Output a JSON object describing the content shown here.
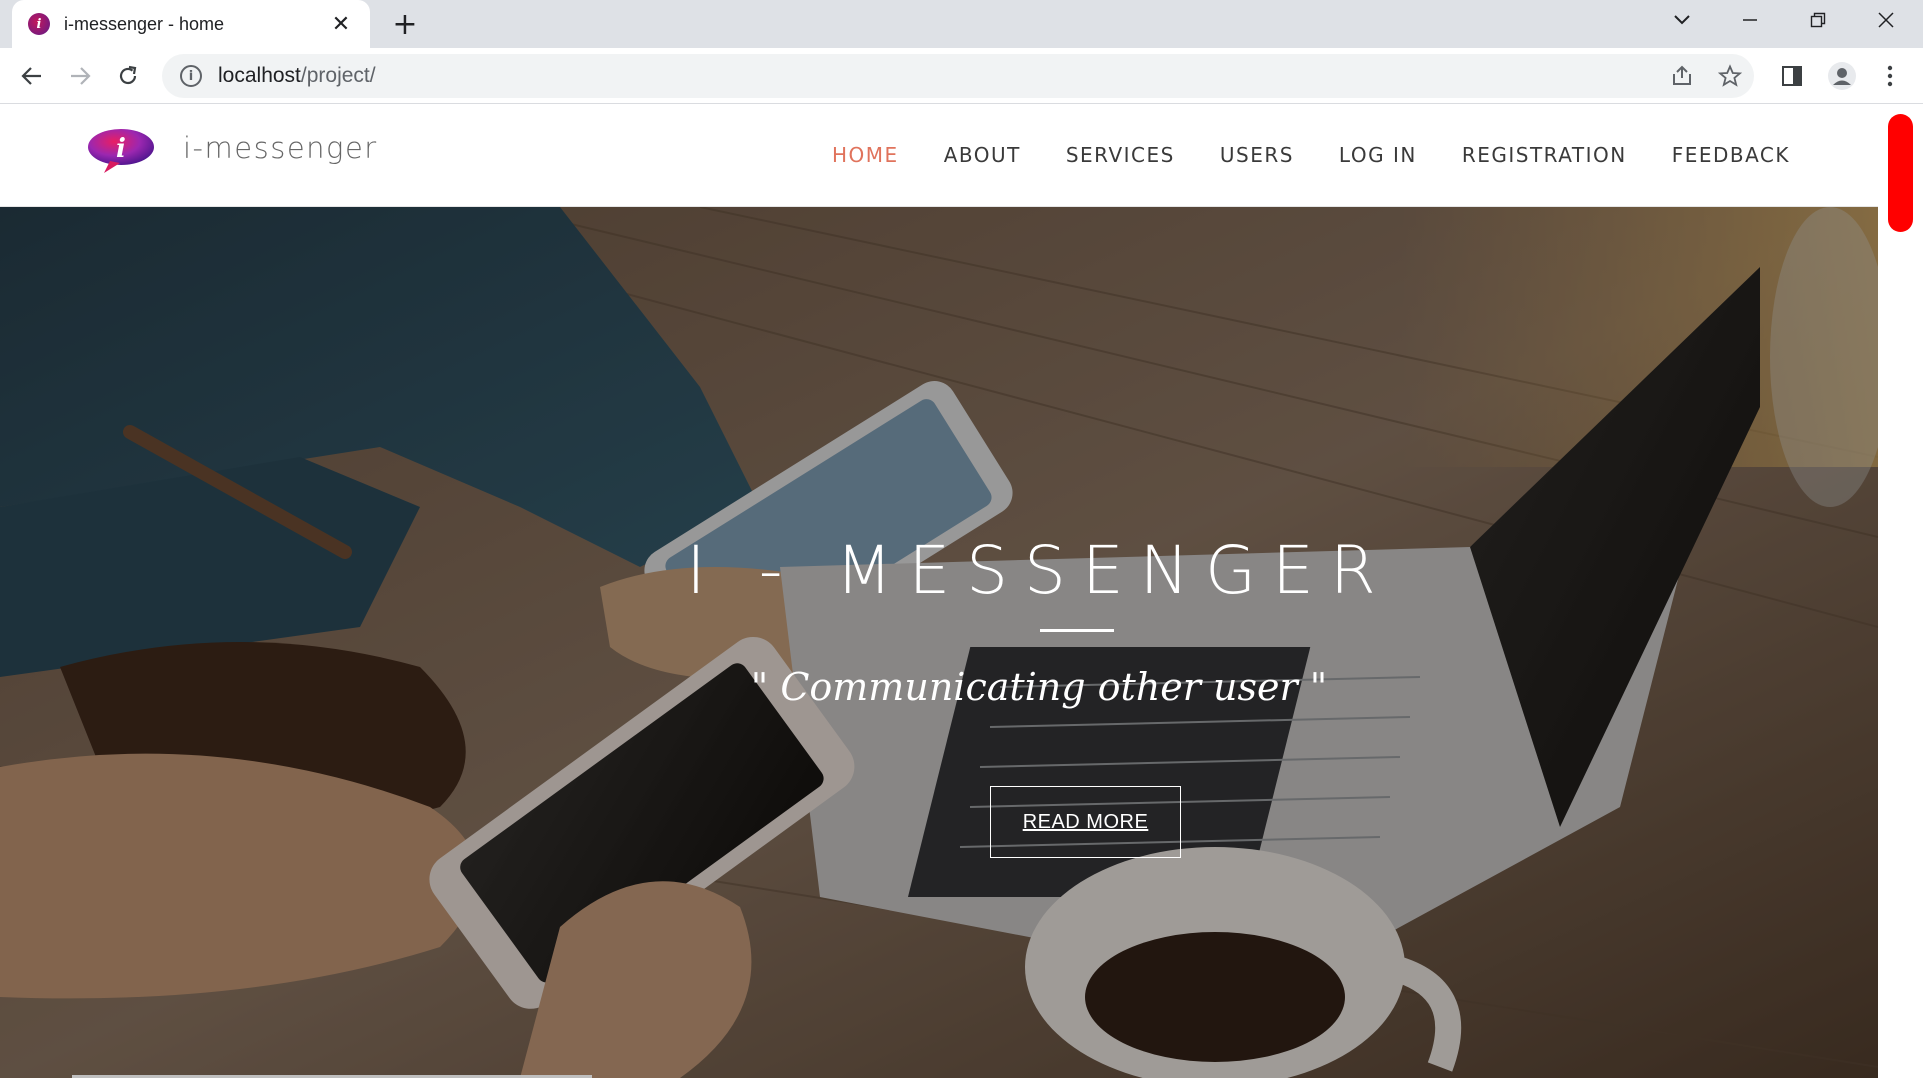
{
  "browser": {
    "tab_title": "i-messenger - home",
    "favicon_letter": "i",
    "close_glyph": "✕",
    "new_tab_glyph": "+",
    "url_host": "localhost",
    "url_path": "/project/"
  },
  "site": {
    "logo_letter": "i",
    "brand": "i-messenger",
    "nav": [
      {
        "label": "HOME",
        "active": true
      },
      {
        "label": "ABOUT"
      },
      {
        "label": "SERVICES"
      },
      {
        "label": "USERS"
      },
      {
        "label": "LOG IN"
      },
      {
        "label": "REGISTRATION"
      },
      {
        "label": "FEEDBACK"
      }
    ]
  },
  "hero": {
    "title": "I - MESSENGER",
    "subtitle": "\" Communicating other user \"",
    "button": "READ MORE"
  },
  "colors": {
    "nav_active": "#e0735c",
    "logo_primary": "#7b1fa2",
    "logo_accent": "#e91e63",
    "scroll_thumb": "#ff0000"
  }
}
